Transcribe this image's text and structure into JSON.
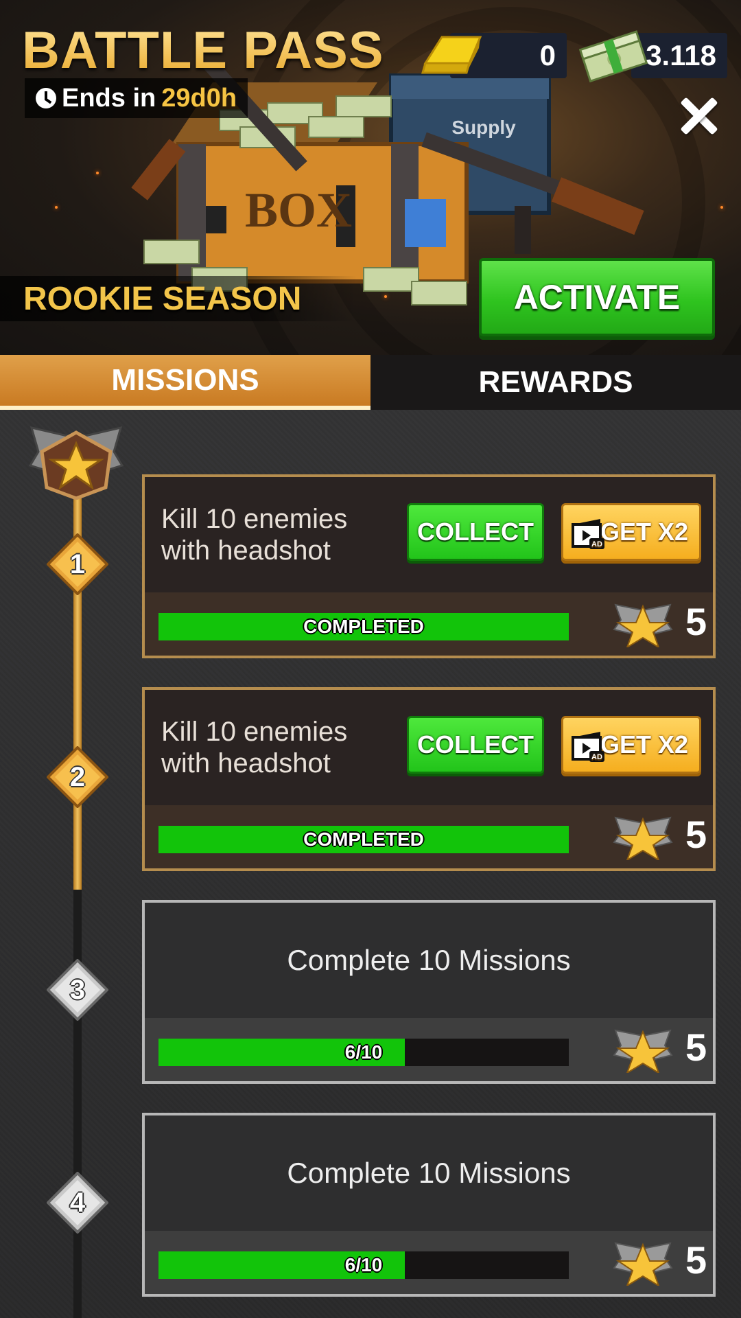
{
  "header": {
    "title": "BATTLE PASS",
    "timer_prefix": "Ends in",
    "timer_value": "29d0h",
    "gold_amount": "0",
    "cash_amount": "3.118",
    "season": "ROOKIE SEASON",
    "activate_label": "ACTIVATE",
    "art_crate_text": "BOX",
    "art_supply_text": "Supply"
  },
  "tabs": [
    {
      "label": "MISSIONS",
      "active": true
    },
    {
      "label": "REWARDS",
      "active": false
    }
  ],
  "missions": [
    {
      "number": "1",
      "text_line1": "Kill 10 enemies",
      "text_line2": "with headshot",
      "collect_label": "COLLECT",
      "x2_label": "GET X2",
      "ad_badge": "AD",
      "progress_label": "COMPLETED",
      "progress": 1.0,
      "reward": "5"
    },
    {
      "number": "2",
      "text_line1": "Kill 10 enemies",
      "text_line2": "with headshot",
      "collect_label": "COLLECT",
      "x2_label": "GET X2",
      "ad_badge": "AD",
      "progress_label": "COMPLETED",
      "progress": 1.0,
      "reward": "5"
    },
    {
      "number": "3",
      "text": "Complete 10 Missions",
      "progress_label": "6/10",
      "progress": 0.6,
      "reward": "5"
    },
    {
      "number": "4",
      "text": "Complete 10 Missions",
      "progress_label": "6/10",
      "progress": 0.6,
      "reward": "5"
    }
  ],
  "colors": {
    "accent_gold": "#f3c54a",
    "button_green": "#2fc41f",
    "button_orange": "#f5ae1f",
    "progress_green": "#12c40a",
    "tab_active": "#c97a22"
  }
}
